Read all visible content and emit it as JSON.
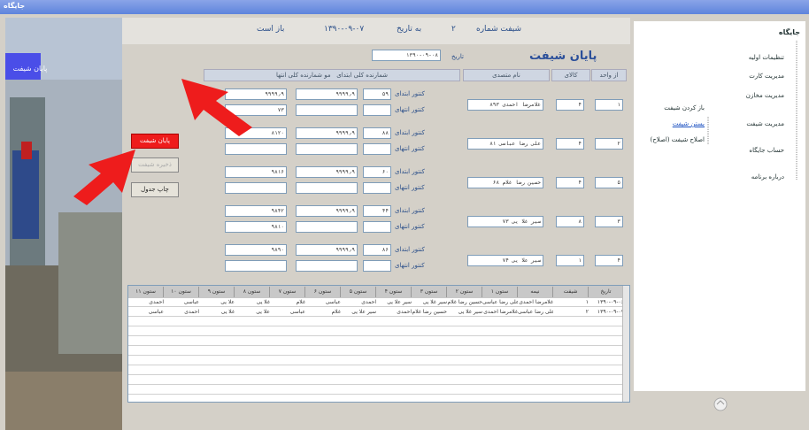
{
  "window": {
    "title": "جایگاه"
  },
  "header": {
    "shift_no_label": "شیفت شماره",
    "shift_no_value": "۲",
    "date_label": "به تاریخ",
    "date_value": "۱۳۹۰-۰۹-۰۷",
    "status": "باز است"
  },
  "form": {
    "title": "پایان شیفت",
    "date_label": "تاریخ",
    "date_value": "۱۳۹۰-۰۹-۰۸"
  },
  "left_banner": "پایان شیفت",
  "columns": {
    "unit": "از واحد",
    "nozzle": "کالای",
    "operator": "نام متصدی",
    "totalizer1": "شمارنده کلی ابتدای",
    "totalizer2": "مو شمارنده کلی انتها"
  },
  "row_labels": {
    "start": "کنتور ابتدای",
    "end": "کنتور انتهای"
  },
  "rows": [
    {
      "unit": "۱",
      "nozzle": "۴",
      "operator": "غلامرضا احمدی ۸۹۳",
      "code": "۵۹",
      "t1": "۹۹۹۹٫۹",
      "t2": "۹۹۹۹٫۹",
      "v": "۷۳"
    },
    {
      "unit": "۲",
      "nozzle": "۴",
      "operator": "علی رضا عباسی ۸۱",
      "code": "۸۸",
      "t1": "۹۹۹۹٫۹",
      "t2": "۸۱۲۰",
      "v": ""
    },
    {
      "unit": "۵",
      "nozzle": "۴",
      "operator": "حسین رضا غلام ۶۸",
      "code": "۶۰",
      "t1": "۹۹۹۹٫۹",
      "t2": "۹۸۱۶",
      "v": ""
    },
    {
      "unit": "۳",
      "nozzle": "۸",
      "operator": "۷۳ سیر غلا یی",
      "code": "۴۴",
      "t1": "۹۹۹۹٫۹",
      "t2": "۹۸۴۲",
      "v": "۹۸۱۰"
    },
    {
      "unit": "۴",
      "nozzle": "۱",
      "operator": "۷۴ سیر علا یی",
      "code": "۸۶",
      "t1": "۹۹۹۹٫۹",
      "t2": "۹۸۹۰",
      "v": ""
    }
  ],
  "buttons": {
    "end": "پایان شیفت",
    "save": "ذخیره شیفت",
    "print": "چاپ جدول"
  },
  "grid": {
    "headers": [
      "تاریخ",
      "شیفت",
      "نیمه",
      "ستون ۱",
      "ستون ۲",
      "ستون ۳",
      "ستون ۴",
      "ستون ۵",
      "ستون ۶",
      "ستون ۷",
      "ستون ۸",
      "ستون ۹",
      "ستون ۱۰",
      "ستون ۱۱"
    ],
    "rows": [
      [
        "۱۳۹۰-۰۹-۰۶",
        "۱",
        "غلامرضا احمدی",
        "علی رضا عباسی",
        "حسین رضا غلام",
        "سیر غلا یی",
        "سیر علا یی",
        "احمدی",
        "عباسی",
        "غلام",
        "غلا یی",
        "علا یی",
        "عباسی",
        "احمدی"
      ],
      [
        "۱۳۹۰-۰۹-۰۷",
        "۲",
        "علی رضا عباسی",
        "غلامرضا احمدی",
        "سیر غلا یی",
        "حسین رضا غلام",
        "احمدی",
        "سیر علا یی",
        "غلام",
        "عباسی",
        "علا یی",
        "غلا یی",
        "احمدی",
        "عباسی"
      ]
    ]
  },
  "tree": {
    "root": "جایگاه",
    "items": [
      "تنظیمات اولیه",
      "مدیریت کارت",
      "مدیریت مخازن",
      "مدیریت شیفت",
      "حساب جایگاه",
      "درباره برنامه"
    ],
    "shift_children": [
      "باز کردن شیفت",
      "بستن شیفت",
      "اصلاح شیفت (اصلاح)"
    ]
  }
}
